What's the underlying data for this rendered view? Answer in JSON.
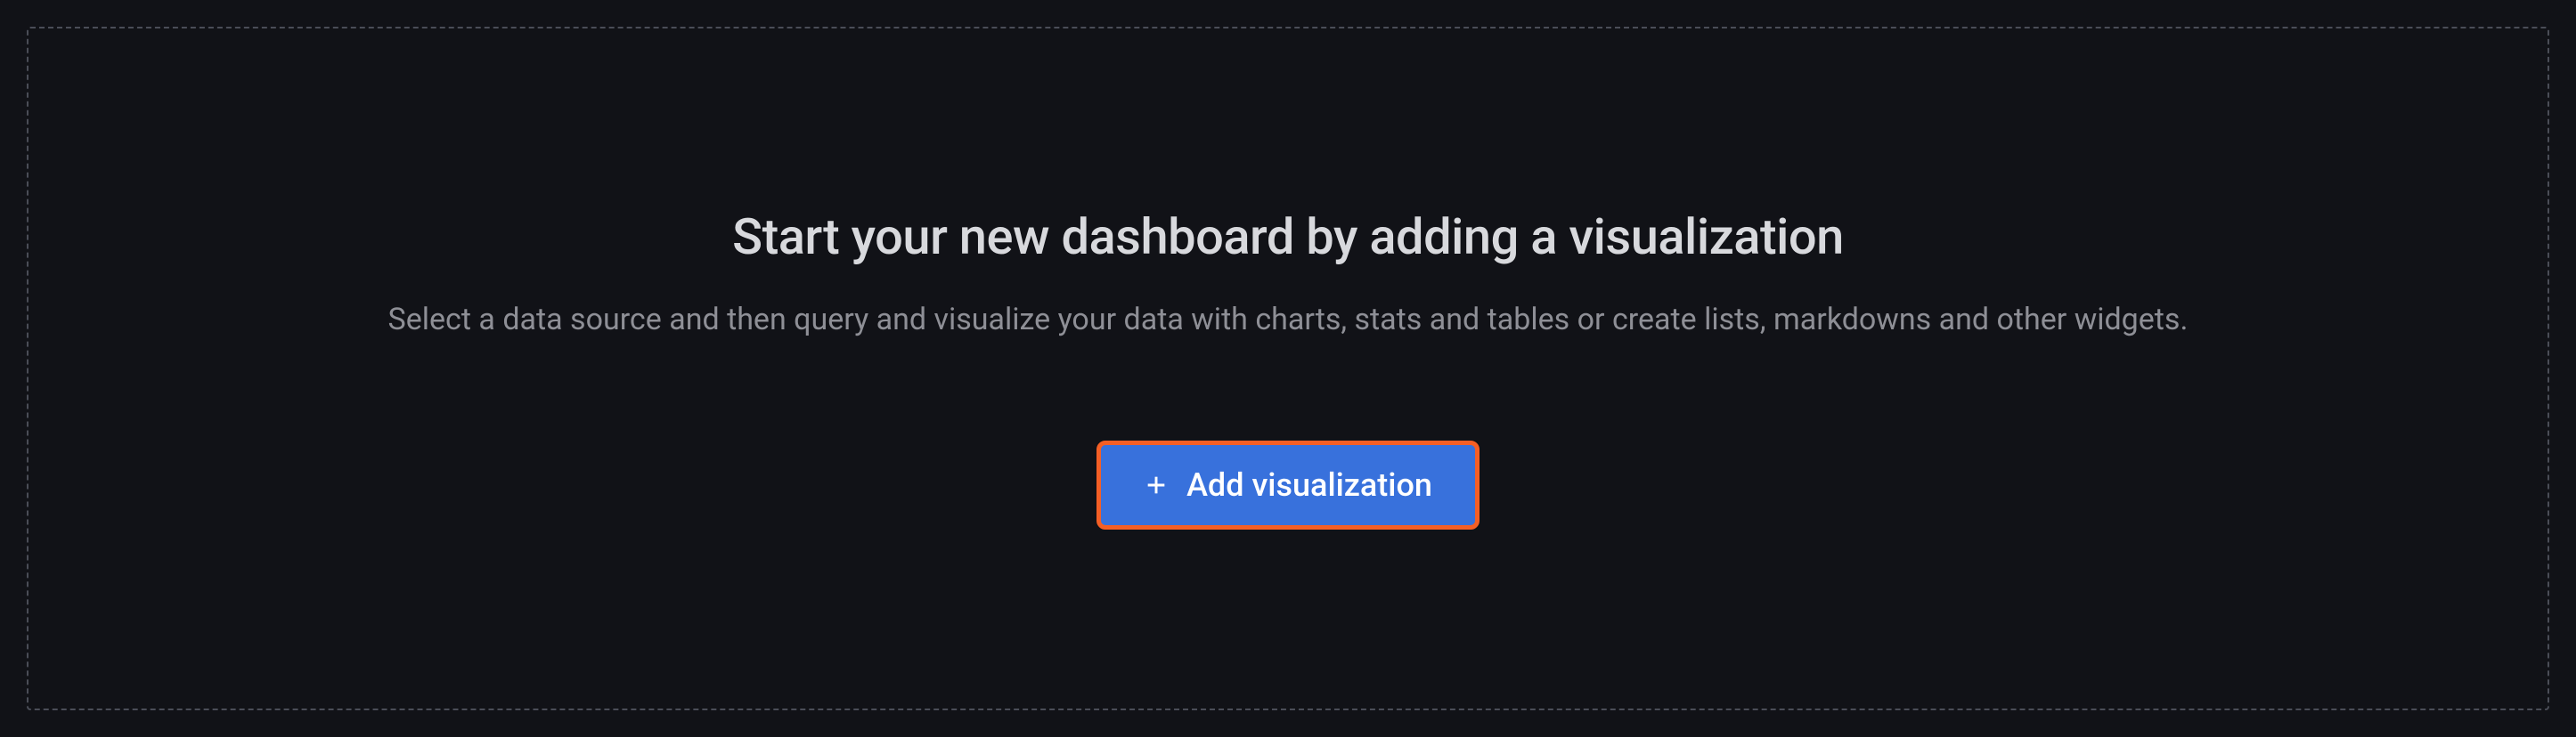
{
  "empty_state": {
    "title": "Start your new dashboard by adding a visualization",
    "description": "Select a data source and then query and visualize your data with charts, stats and tables or create lists, markdowns and other widgets.",
    "button_label": "Add visualization"
  }
}
